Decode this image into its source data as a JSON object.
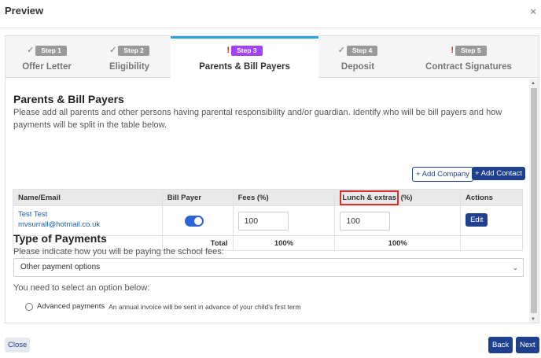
{
  "modal": {
    "title": "Preview",
    "close_glyph": "×"
  },
  "steps": [
    {
      "badge": "Step 1",
      "label": "Offer Letter",
      "status": "complete",
      "mark": "✓"
    },
    {
      "badge": "Step 2",
      "label": "Eligibility",
      "status": "complete",
      "mark": "✓"
    },
    {
      "badge": "Step 3",
      "label": "Parents & Bill Payers",
      "status": "warning",
      "mark": "!",
      "active": true
    },
    {
      "badge": "Step 4",
      "label": "Deposit",
      "status": "complete",
      "mark": "✓"
    },
    {
      "badge": "Step 5",
      "label": "Contract Signatures",
      "status": "warning",
      "mark": "!"
    }
  ],
  "parents": {
    "heading": "Parents & Bill Payers",
    "description": "Please add all parents and other persons having parental responsibility and/or guardian. Identify who will be bill payers and how payments will be split in the table below.",
    "add_company": "+ Add Company",
    "add_contact": "+ Add Contact",
    "table": {
      "headers": {
        "name": "Name/Email",
        "bill_payer": "Bill Payer",
        "fees": "Fees (%)",
        "lunch_highlighted": "Lunch & extras",
        "lunch_suffix": " (%)",
        "actions": "Actions"
      },
      "rows": [
        {
          "name": "Test Test",
          "email": "mvsurrall@hotmail.co.uk",
          "bill_payer": true,
          "fees": "100",
          "lunch": "100",
          "action": "Edit"
        }
      ],
      "total": {
        "label": "Total",
        "fees": "100%",
        "lunch": "100%"
      }
    }
  },
  "payments": {
    "heading": "Type of Payments",
    "description": "Please indicate how you will be paying the school fees:",
    "select_value": "Other payment options",
    "notice": "You need to select an option below:",
    "option_label": "Advanced payments",
    "option_desc": "An annual invoice will be sent in advance of your child's first term"
  },
  "footer": {
    "close": "Close",
    "back": "Back",
    "next": "Next"
  },
  "colors": {
    "primary": "#1f3f8f",
    "accent": "#29a3e0",
    "step3_badge": "#a142f4",
    "warning": "#d9302c"
  }
}
